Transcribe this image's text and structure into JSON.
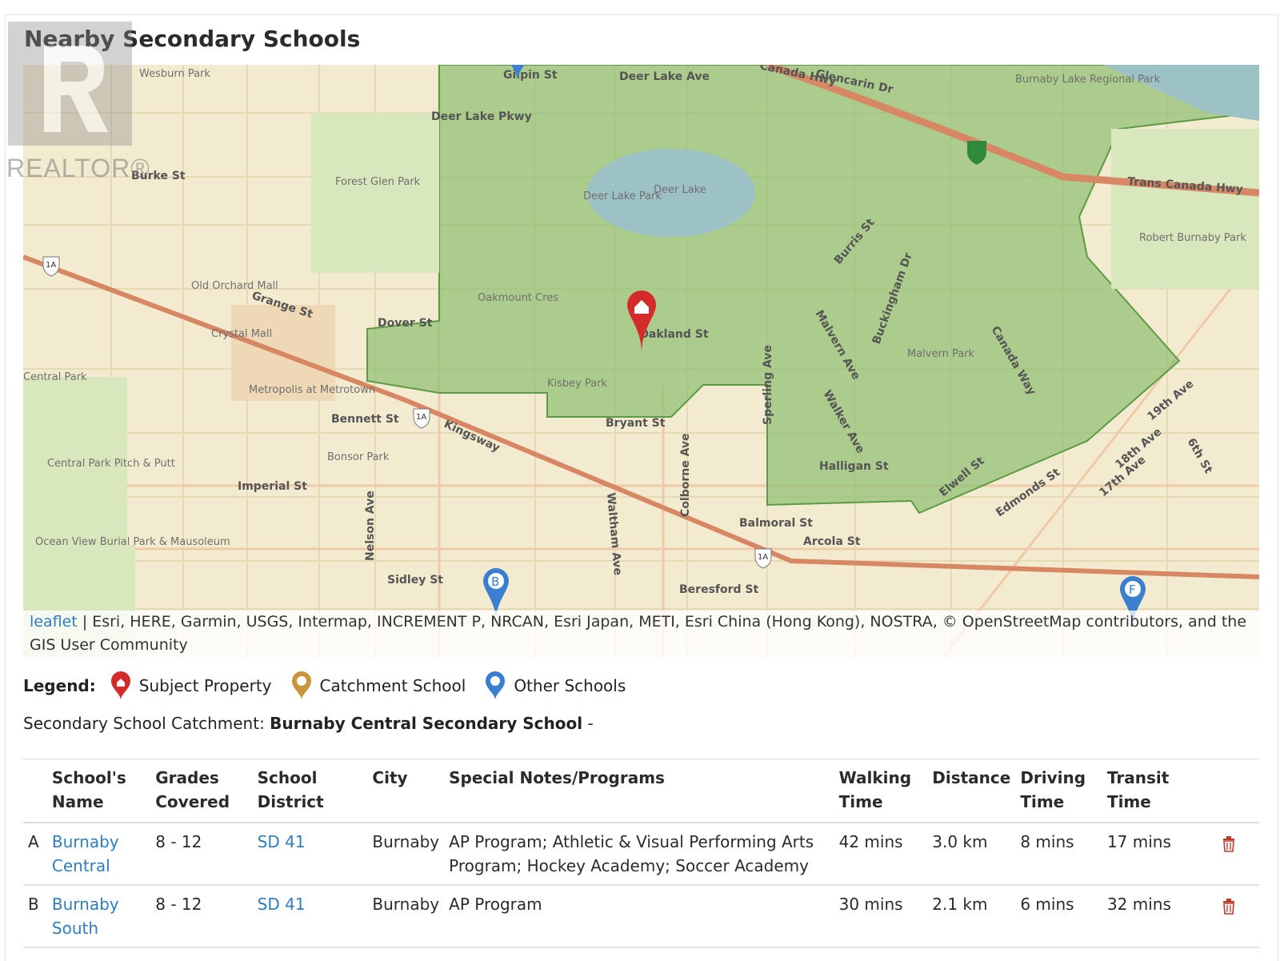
{
  "title": "Nearby Secondary Schools",
  "watermark": "REALTOR®",
  "map": {
    "labels": {
      "wesburn": "Wesburn Park",
      "gilpin": "Gilpin St",
      "deer_lake_ave": "Deer Lake Ave",
      "deer_lake_pkwy": "Deer Lake Pkwy",
      "glencarin": "Glencarin Dr",
      "canada_hwy": "Canada Hwy",
      "burnaby_lake": "Burnaby Lake Regional Park",
      "trans_canada": "Trans Canada Hwy",
      "forest_glen": "Forest Glen Park",
      "deer_lake_park": "Deer Lake Park",
      "deer_lake": "Deer Lake",
      "robert_burnaby": "Robert Burnaby Park",
      "burke": "Burke St",
      "old_orchard": "Old Orchard Mall",
      "grange": "Grange St",
      "oakmount": "Oakmount Cres",
      "dover": "Dover St",
      "oakland": "Oakland St",
      "burris": "Burris St",
      "buckingham": "Buckingham Dr",
      "malvern_ave": "Malvern Ave",
      "malvern_park": "Malvern Park",
      "canada_way": "Canada Way",
      "crystal": "Crystal Mall",
      "metropolis": "Metropolis at Metrotown",
      "central_park": "Central Park",
      "kisbey": "Kisbey Park",
      "bennett": "Bennett St",
      "kingsway": "Kingsway",
      "bryant": "Bryant St",
      "walker": "Walker Ave",
      "sperling": "Sperling Ave",
      "colborne": "Colborne Ave",
      "halligan": "Halligan St",
      "elwell": "Elwell St",
      "edmonds": "Edmonds St",
      "pitch_putt": "Central Park Pitch & Putt",
      "bonsor": "Bonsor Park",
      "imperial": "Imperial St",
      "waltham": "Waltham Ave",
      "balmoral": "Balmoral St",
      "arcola": "Arcola St",
      "ocean_view": "Ocean View Burial Park & Mausoleum",
      "nelson": "Nelson Ave",
      "sidley": "Sidley St",
      "beresford": "Beresford St",
      "ave_18": "18th Ave",
      "ave_17": "17th Ave",
      "ave_19": "19th Ave",
      "st_6": "6th St",
      "hwy_1a": "1A",
      "marker_b": "B",
      "marker_f": "F"
    },
    "attribution_link": "leaflet",
    "attribution_text": " | Esri, HERE, Garmin, USGS, Intermap, INCREMENT P, NRCAN, Esri Japan, METI, Esri China (Hong Kong), NOSTRA, © OpenStreetMap contributors, and the GIS User Community"
  },
  "legend": {
    "label": "Legend:",
    "subject": "Subject Property",
    "catchment": "Catchment School",
    "other": "Other Schools",
    "colors": {
      "subject": "#d42a2a",
      "catchment": "#c8963a",
      "other": "#3a7fd0"
    }
  },
  "catchment": {
    "label": "Secondary School Catchment:",
    "value": "Burnaby Central Secondary School",
    "suffix": "-"
  },
  "table": {
    "headers": {
      "name_1": "School's",
      "name_2": "Name",
      "grades_1": "Grades",
      "grades_2": "Covered",
      "district_1": "School",
      "district_2": "District",
      "city": "City",
      "notes": "Special Notes/Programs",
      "walk_1": "Walking",
      "walk_2": "Time",
      "distance": "Distance",
      "drive_1": "Driving",
      "drive_2": "Time",
      "transit_1": "Transit",
      "transit_2": "Time"
    },
    "rows": [
      {
        "letter": "A",
        "name_1": "Burnaby",
        "name_2": "Central",
        "grades": "8 - 12",
        "district": "SD 41",
        "city": "Burnaby",
        "notes": "AP Program; Athletic & Visual Performing Arts Program; Hockey Academy; Soccer Academy",
        "walking": "42 mins",
        "distance": "3.0 km",
        "driving": "8 mins",
        "transit": "17 mins"
      },
      {
        "letter": "B",
        "name_1": "Burnaby",
        "name_2": "South",
        "grades": "8 - 12",
        "district": "SD 41",
        "city": "Burnaby",
        "notes": "AP Program",
        "walking": "30 mins",
        "distance": "2.1 km",
        "driving": "6 mins",
        "transit": "32 mins"
      }
    ]
  }
}
